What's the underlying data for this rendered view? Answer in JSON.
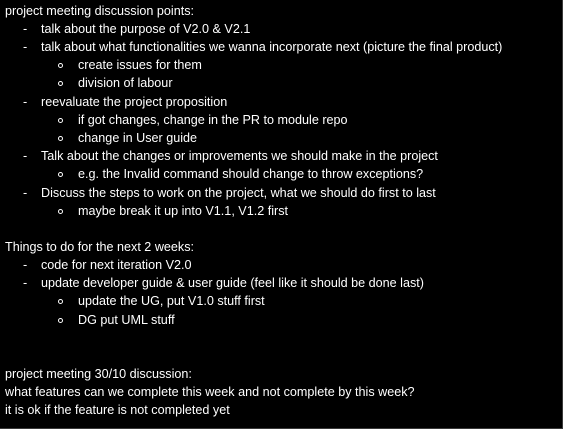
{
  "document": {
    "section1": {
      "heading": "project meeting discussion points:",
      "items": [
        {
          "text": "talk about the purpose of V2.0 & V2.1",
          "sub": []
        },
        {
          "text": "talk about what functionalities we wanna incorporate next (picture the final product)",
          "sub": [
            "create issues for them",
            "division of labour"
          ]
        },
        {
          "text": "reevaluate the project proposition",
          "sub": [
            "if got changes, change in the PR to module repo",
            "change in User guide"
          ]
        },
        {
          "text": "Talk about the changes or improvements we should make in the project",
          "sub": [
            "e.g. the Invalid command should change to throw exceptions?"
          ]
        },
        {
          "text": "Discuss the steps to work on the project, what we should do first to last",
          "sub": [
            "maybe break it up into V1.1, V1.2 first"
          ]
        }
      ]
    },
    "section2": {
      "heading": "Things to do for the next 2 weeks:",
      "items": [
        {
          "text": "code for next iteration V2.0",
          "sub": []
        },
        {
          "text": "update developer guide & user guide (feel like it should be done last)",
          "sub": [
            "update the UG, put V1.0 stuff first",
            "DG put UML stuff"
          ]
        }
      ]
    },
    "section3": {
      "heading": "project meeting 30/10 discussion:",
      "lines": [
        "what features can we complete this week and not complete by this week?",
        "it is ok if the feature is not completed yet"
      ]
    }
  }
}
